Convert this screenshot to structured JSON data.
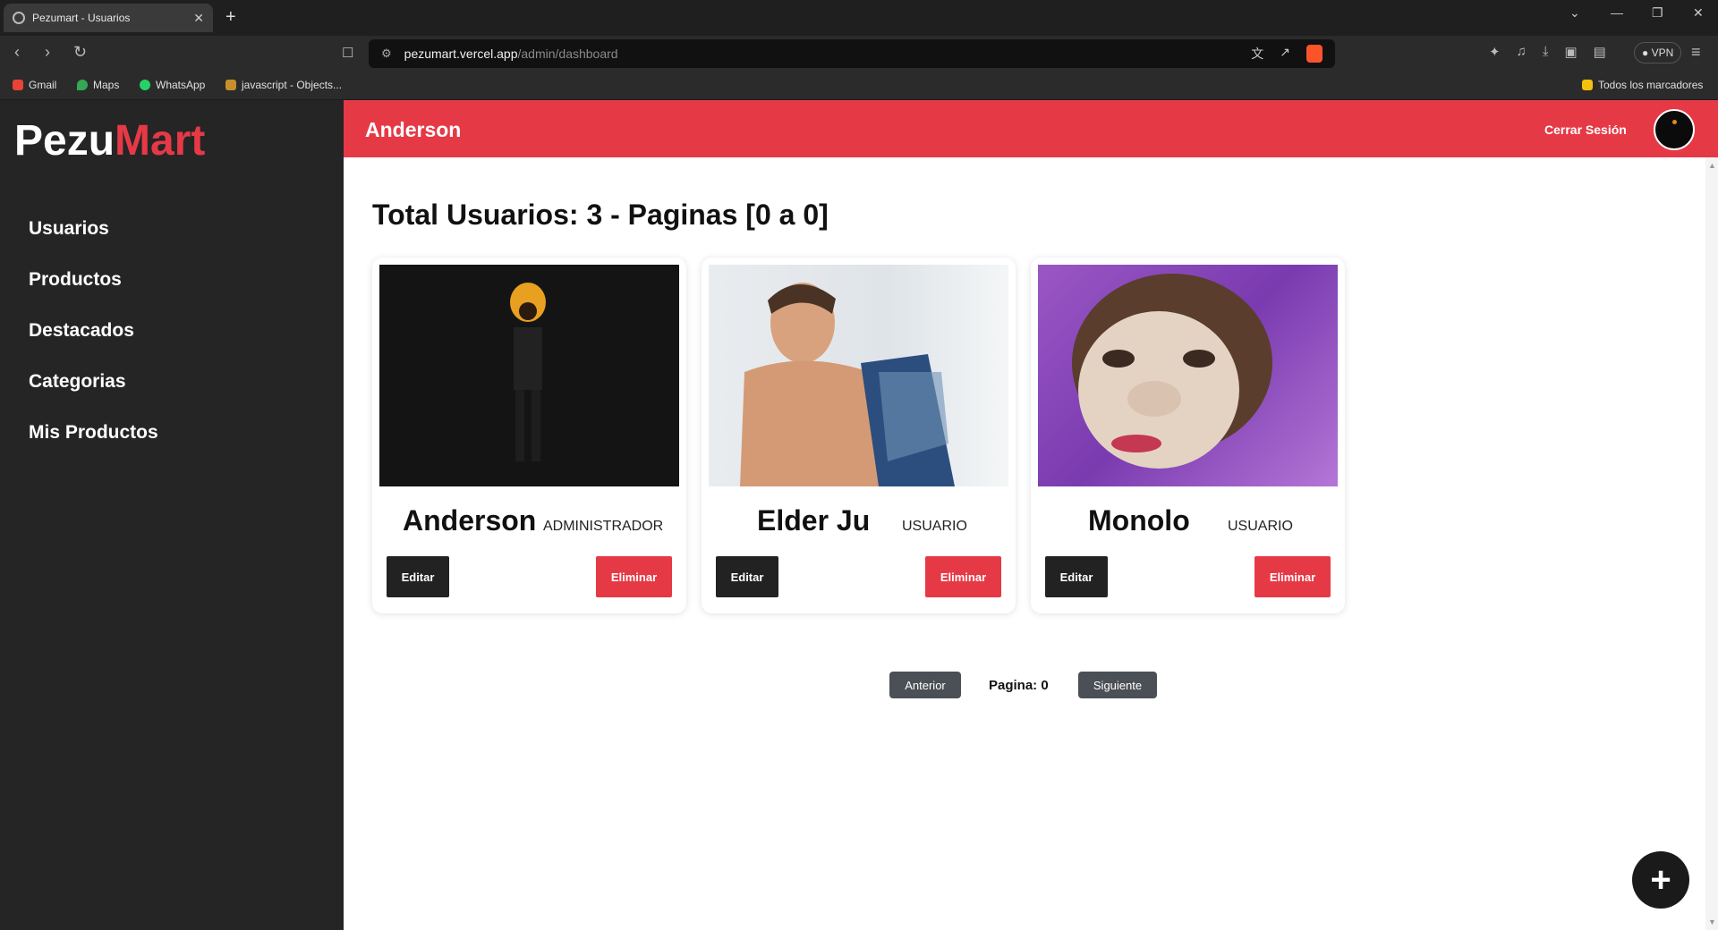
{
  "browser": {
    "tab_title": "Pezumart - Usuarios",
    "url_host": "pezumart.vercel.app",
    "url_path": "/admin/dashboard",
    "vpn_label": "VPN",
    "bookmarks": [
      "Gmail",
      "Maps",
      "WhatsApp",
      "javascript - Objects..."
    ],
    "all_bookmarks": "Todos los marcadores"
  },
  "brand": {
    "part1": "Pezu",
    "part2": "Mart",
    "accent": "#e63946"
  },
  "sidebar": {
    "items": [
      {
        "label": "Usuarios"
      },
      {
        "label": "Productos"
      },
      {
        "label": "Destacados"
      },
      {
        "label": "Categorias"
      },
      {
        "label": "Mis Productos"
      }
    ]
  },
  "header": {
    "user": "Anderson",
    "logout": "Cerrar Sesión"
  },
  "main": {
    "title": "Total Usuarios: 3 - Paginas [0 a 0]",
    "edit_label": "Editar",
    "delete_label": "Eliminar",
    "users": [
      {
        "name": "Anderson",
        "role": "ADMINISTRADOR"
      },
      {
        "name": "Elder Ju",
        "role": "USUARIO"
      },
      {
        "name": "Monolo",
        "role": "USUARIO"
      }
    ]
  },
  "pagination": {
    "prev": "Anterior",
    "page_text": "Pagina: 0",
    "next": "Siguiente"
  },
  "fab": {
    "icon": "+"
  }
}
